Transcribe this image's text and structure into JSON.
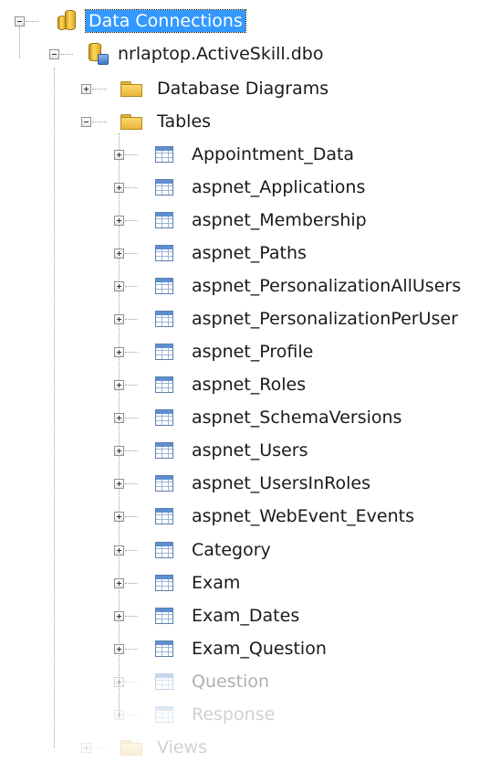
{
  "root": {
    "label": "Data Connections",
    "connection": {
      "label": "nrlaptop.ActiveSkill.dbo",
      "folders": {
        "database_diagrams": "Database Diagrams",
        "tables": "Tables",
        "views": "Views"
      }
    }
  },
  "tables": [
    "Appointment_Data",
    "aspnet_Applications",
    "aspnet_Membership",
    "aspnet_Paths",
    "aspnet_PersonalizationAllUsers",
    "aspnet_PersonalizationPerUser",
    "aspnet_Profile",
    "aspnet_Roles",
    "aspnet_SchemaVersions",
    "aspnet_Users",
    "aspnet_UsersInRoles",
    "aspnet_WebEvent_Events",
    "Category",
    "Exam",
    "Exam_Dates",
    "Exam_Question",
    "Question",
    "Response"
  ],
  "colors": {
    "selection": "#3399ff",
    "text": "#1a1a1a",
    "table_icon": "#5e8fd1",
    "folder": "#f9d86d"
  }
}
